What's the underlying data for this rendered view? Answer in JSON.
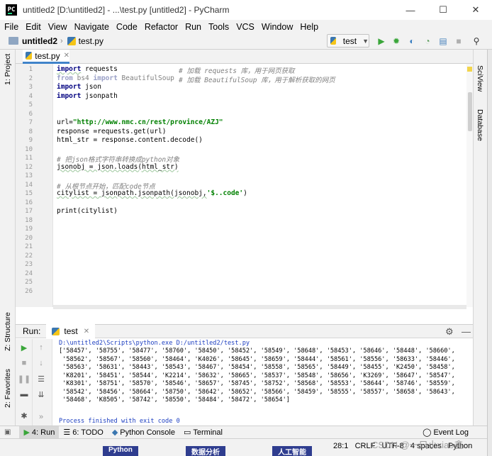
{
  "window": {
    "title": "untitled2 [D:\\untitled2] - ...\\test.py [untitled2] - PyCharm",
    "logo_text": "PC",
    "minimize": "—",
    "maximize": "☐",
    "close": "✕"
  },
  "menu": [
    "File",
    "Edit",
    "View",
    "Navigate",
    "Code",
    "Refactor",
    "Run",
    "Tools",
    "VCS",
    "Window",
    "Help"
  ],
  "navbar": {
    "project": "untitled2",
    "file": "test.py",
    "run_config": "test"
  },
  "left_stripe": {
    "project": "1: Project",
    "structure": "Z: Structure",
    "favorites": "2: Favorites"
  },
  "right_stripe": {
    "sciview": "SciView",
    "database": "Database"
  },
  "editor": {
    "tab_label": "test.py",
    "line_numbers": [
      "1",
      "2",
      "3",
      "4",
      "5",
      "6",
      "7",
      "8",
      "9",
      "10",
      "11",
      "12",
      "13",
      "14",
      "15",
      "16",
      "17",
      "18",
      "19",
      "20",
      "21",
      "22",
      "23",
      "24",
      "25",
      "26"
    ],
    "code": {
      "l1_kw": "import",
      "l1_mod": " requests",
      "l1_cmt": "# 加载 requests 库，用于网页获取",
      "l2_kw1": "from",
      "l2_mod": " bs4 ",
      "l2_kw2": "import",
      "l2_name": " BeautifulSoup",
      "l2_cmt": "# 加载 BeautifulSoup 库，用于解析获取的网页",
      "l3_kw": "import",
      "l3_mod": " json",
      "l4_kw": "import",
      "l4_mod": " jsonpath",
      "l7_pre": "url=",
      "l7_str": "\"http://www.nmc.cn/rest/province/AZJ\"",
      "l8": "response =requests.get(url)",
      "l9": "html_str = response.content.decode()",
      "l11_cmt": "# 把json格式字符串转换成python对象",
      "l12": "jsonobj = json.loads(html_str)",
      "l14_cmt": "# 从根节点开始，匹配code节点",
      "l15_pre": "citylist = jsonpath.jsonpath(jsonobj,",
      "l15_str": "'$..code'",
      "l15_post": ")",
      "l17": "print(citylist)"
    }
  },
  "run_panel": {
    "title": "Run:",
    "tab": "test",
    "command": "D:\\untitled2\\Scripts\\python.exe D:/untitled2/test.py",
    "output_lines": [
      "['58457', '58755', '58477', '58760', '58450', '58452', '58549', '58648', '58453', '58646', '58448', '58660',",
      " '58562', '58567', '58560', '58464', 'K4026', '58645', '58659', '58444', '58561', '58556', '58633', '58446',",
      " '58563', '58631', '58443', '58543', '58467', '58454', '58558', '58565', '58449', '58455', 'K2450', '58458',",
      " 'K8201', '58451', '58544', 'K2214', '58632', '58665', '58537', '58548', '58656', 'K3269', '58647', '58547',",
      " 'K8301', '58751', '58570', '58546', '58657', '58745', '58752', '58568', '58553', '58644', '58746', '58559',",
      " '58542', '58456', '58664', '58750', '58642', '58652', '58566', '58459', '58555', '58557', '58658', '58643',",
      " '58468', 'K8505', '58742', '58550', '58484', '58472', '58654']"
    ],
    "exit_message": "Process finished with exit code 0"
  },
  "bottom_tools": {
    "run": "4: Run",
    "todo": "6: TODO",
    "console": "Python Console",
    "terminal": "Terminal",
    "event_log": "Event Log"
  },
  "status": {
    "position": "28:1",
    "line_sep": "CRLF",
    "encoding": "UTF-8",
    "indent": "4 spaces",
    "interpreter": "Python"
  },
  "watermark": "CSDN @一只小xiao鑫",
  "taskbar": [
    "Python",
    "数据分析",
    "人工智能"
  ]
}
